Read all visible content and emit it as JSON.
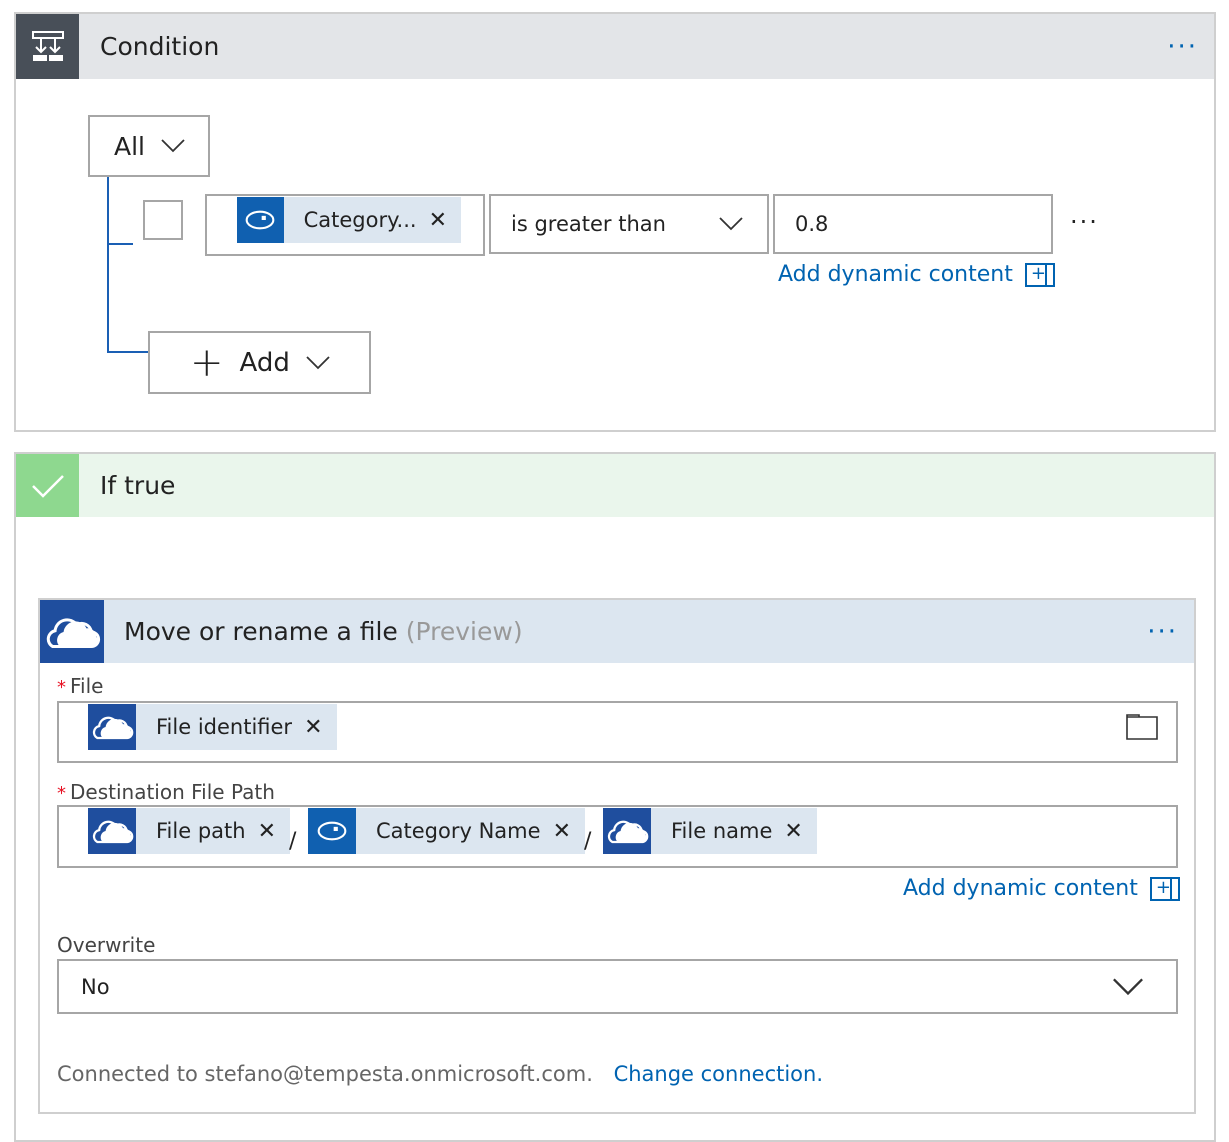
{
  "condition": {
    "title": "Condition",
    "icon": "condition-icon",
    "more": "···",
    "group_operator": "All",
    "row": {
      "token_label": "Category...",
      "token_icon": "eye-icon",
      "operator": "is greater than",
      "value": "0.8",
      "more": "···"
    },
    "add_dynamic_content": "Add dynamic content",
    "add_label": "Add"
  },
  "if_true": {
    "title": "If true",
    "icon": "checkmark-icon",
    "action": {
      "title": "Move or rename a file",
      "title_suffix": "(Preview)",
      "icon": "onedrive-cloud-icon",
      "more": "···",
      "file": {
        "label": "File",
        "required": "*",
        "tokens": [
          {
            "label": "File identifier",
            "icon": "onedrive-cloud-icon"
          }
        ]
      },
      "destination": {
        "label": "Destination File Path",
        "required": "*",
        "tokens": [
          {
            "label": "File path",
            "icon": "onedrive-cloud-icon"
          },
          {
            "label": "Category Name",
            "icon": "eye-icon"
          },
          {
            "label": "File name",
            "icon": "onedrive-cloud-icon"
          }
        ],
        "separator": "/"
      },
      "add_dynamic_content": "Add dynamic content",
      "overwrite": {
        "label": "Overwrite",
        "value": "No"
      },
      "footer": {
        "connected_text": "Connected to stefano@tempesta.onmicrosoft.com.",
        "change_connection": "Change connection."
      }
    }
  },
  "colors": {
    "accent": "#0063b1",
    "condition_header": "#e3e5e8",
    "condition_icon_bg": "#484f58",
    "true_header": "#eaf6ec",
    "true_icon_bg": "#8ed88f",
    "action_header": "#dce6f0",
    "action_icon_bg": "#1f4e9e",
    "eye_token_bg": "#1060b0"
  }
}
